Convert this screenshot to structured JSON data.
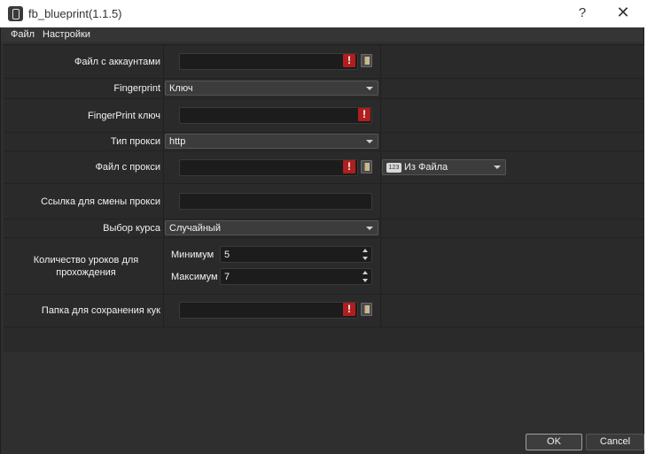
{
  "window": {
    "title": "fb_blueprint(1.1.5)",
    "help": "?",
    "close": "✕"
  },
  "menu": {
    "file": "Файл",
    "settings": "Настройки"
  },
  "form": {
    "accounts_label": "Файл с аккаунтами",
    "accounts_value": "",
    "fingerprint_label": "Fingerprint",
    "fingerprint_value": "Ключ",
    "fingerprint_key_label": "FingerPrint ключ",
    "fingerprint_key_value": "",
    "proxy_type_label": "Тип прокси",
    "proxy_type_value": "http",
    "proxy_file_label": "Файл с прокси",
    "proxy_file_value": "",
    "proxy_source_badge": "123",
    "proxy_source_value": "Из Файла",
    "proxy_change_label": "Ссылка для смены прокси",
    "proxy_change_value": "",
    "course_label": "Выбор курса",
    "course_value": "Случайный",
    "lessons_label": "Количество уроков для прохождения",
    "min_label": "Минимум",
    "min_value": "5",
    "max_label": "Максимум",
    "max_value": "7",
    "cookies_label": "Папка для сохранения кук",
    "cookies_value": "",
    "warning_glyph": "!"
  },
  "buttons": {
    "ok": "OK",
    "cancel": "Cancel"
  },
  "colors": {
    "background": "#2f2f2f",
    "field": "#1c1c1c",
    "warning": "#b01e1e"
  }
}
